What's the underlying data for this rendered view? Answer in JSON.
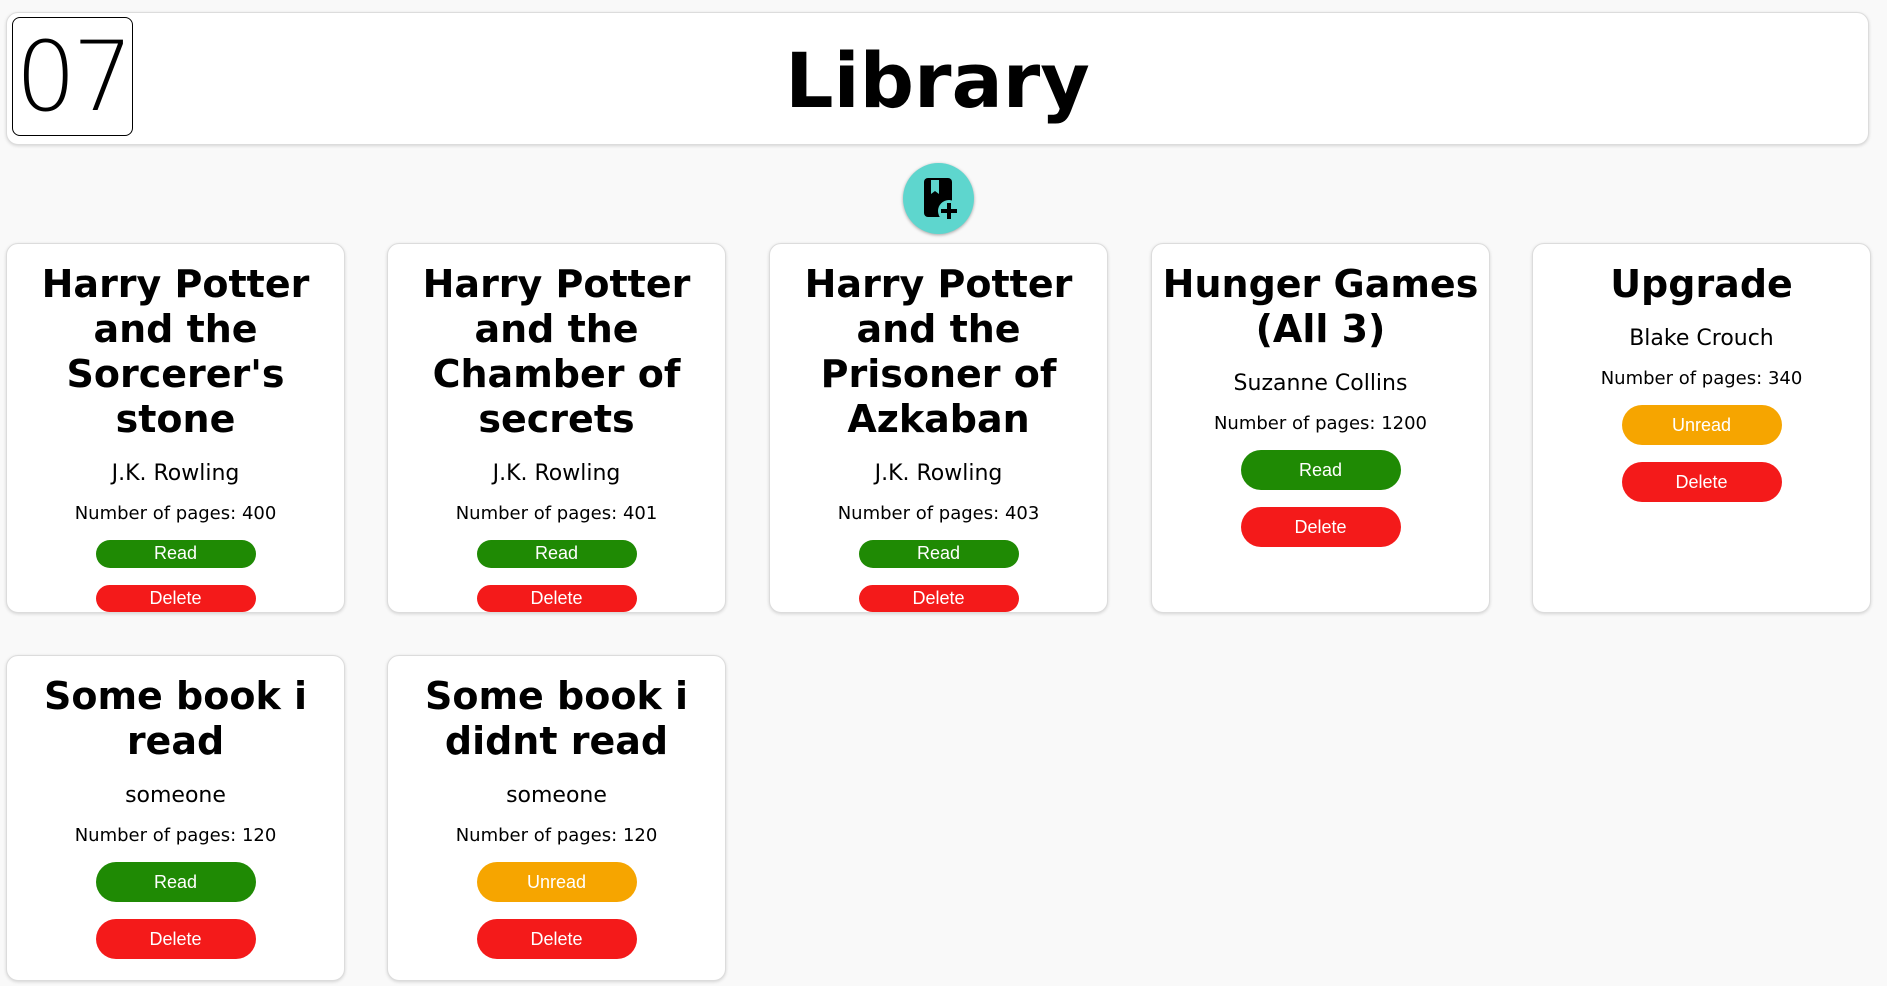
{
  "header": {
    "logo_text": "07",
    "title": "Library"
  },
  "add_button": {
    "icon": "bookmark-add-icon"
  },
  "labels": {
    "pages_prefix": "Number of pages: ",
    "delete": "Delete"
  },
  "colors": {
    "read": "#1f8a04",
    "unread": "#f6a500",
    "delete": "#f41a1a",
    "add_button": "#5ed6ce"
  },
  "books": [
    {
      "title": "Harry Potter and the Sorcerer's stone",
      "author": "J.K. Rowling",
      "pages": 400,
      "status": "Read"
    },
    {
      "title": "Harry Potter and the Chamber of secrets",
      "author": "J.K. Rowling",
      "pages": 401,
      "status": "Read"
    },
    {
      "title": "Harry Potter and the Prisoner of Azkaban",
      "author": "J.K. Rowling",
      "pages": 403,
      "status": "Read"
    },
    {
      "title": "Hunger Games (All 3)",
      "author": "Suzanne Collins",
      "pages": 1200,
      "status": "Read"
    },
    {
      "title": "Upgrade",
      "author": "Blake Crouch",
      "pages": 340,
      "status": "Unread"
    },
    {
      "title": "Some book i read",
      "author": "someone",
      "pages": 120,
      "status": "Read"
    },
    {
      "title": "Some book i didnt read",
      "author": "someone",
      "pages": 120,
      "status": "Unread"
    }
  ]
}
